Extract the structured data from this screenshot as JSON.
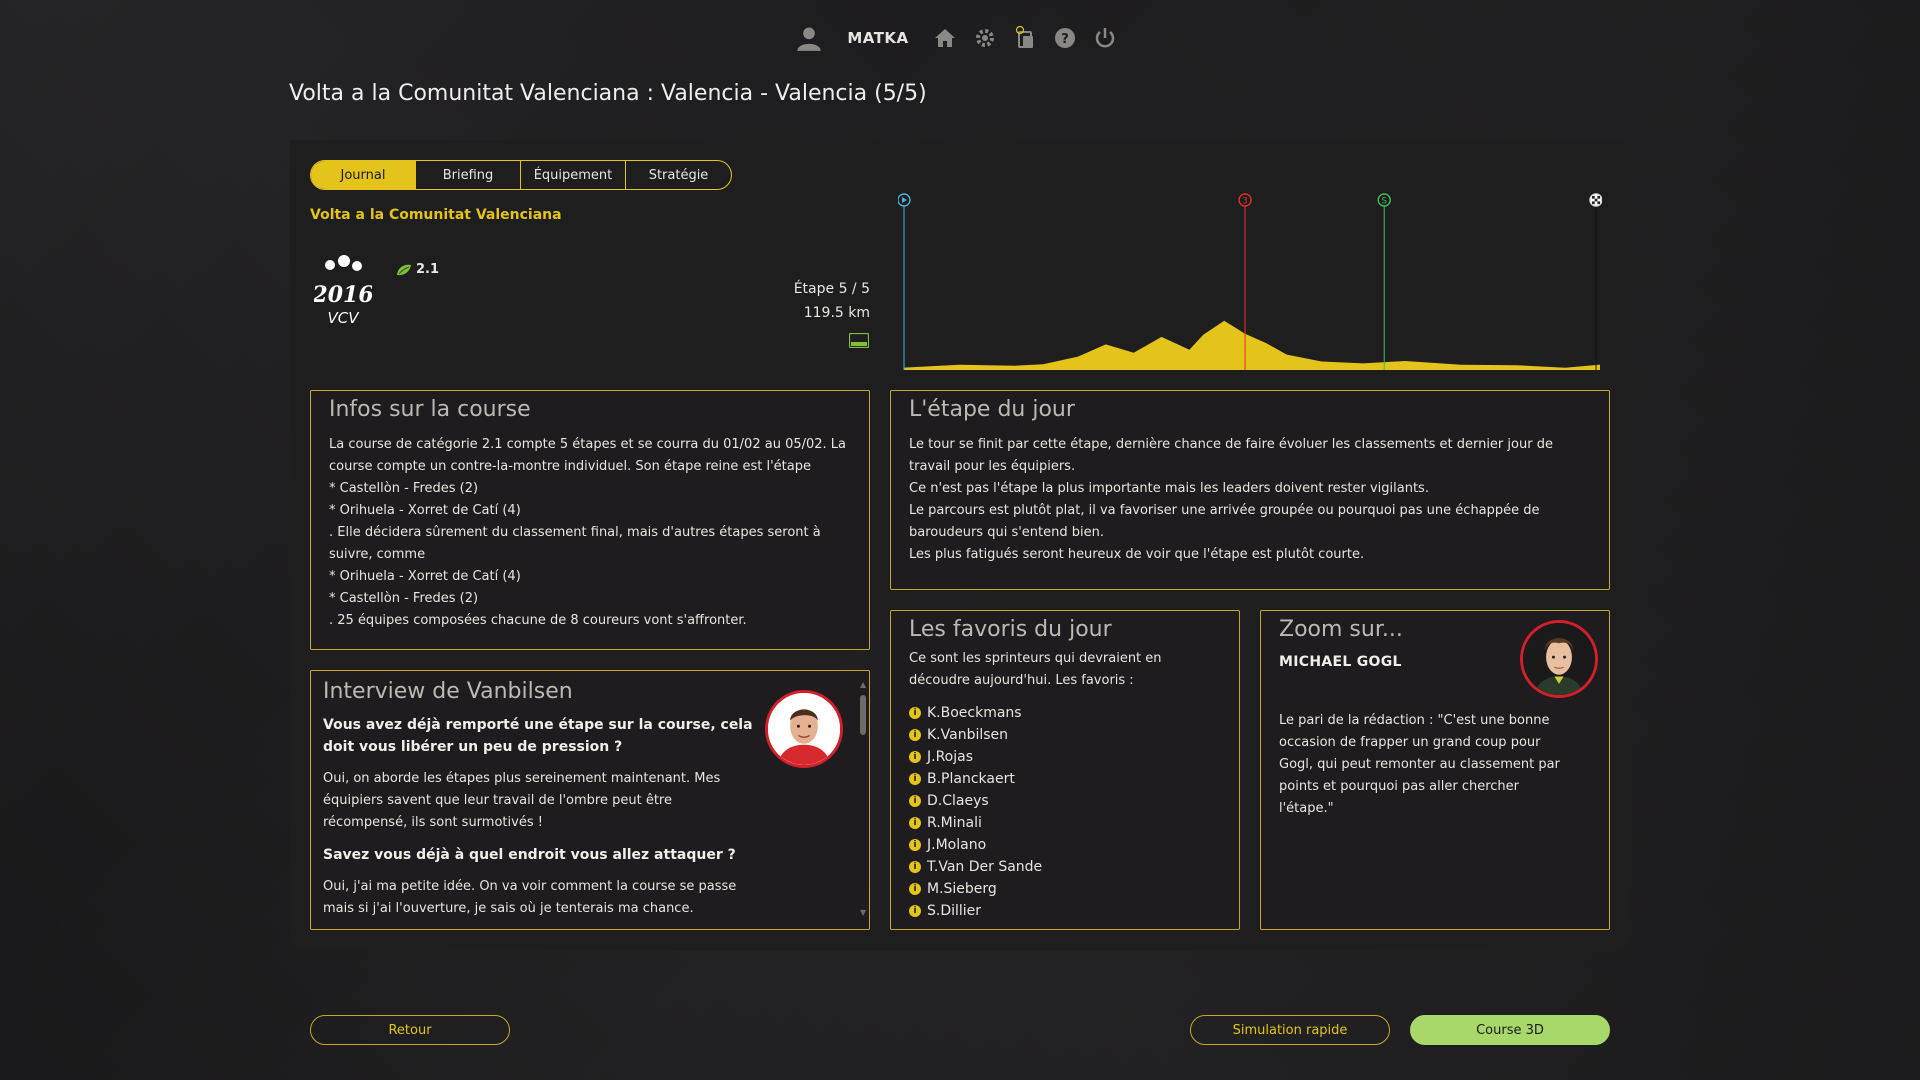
{
  "topbar": {
    "username": "MATKA",
    "icons": [
      "user-icon",
      "home-icon",
      "gear-icon",
      "cards-icon",
      "help-icon",
      "power-icon"
    ]
  },
  "page_title": "Volta a la Comunitat Valenciana : Valencia - Valencia (5/5)",
  "tabs": [
    {
      "label": "Journal",
      "active": true
    },
    {
      "label": "Briefing",
      "active": false
    },
    {
      "label": "Équipement",
      "active": false
    },
    {
      "label": "Stratégie",
      "active": false
    }
  ],
  "race": {
    "name": "Volta a la Comunitat Valenciana",
    "logo_year": "2016",
    "logo_abbr": "VCV",
    "category": "2.1",
    "stage": "Étape 5 / 5",
    "distance": "119.5 km"
  },
  "profile": {
    "markers": [
      {
        "type": "start",
        "label": "",
        "color": "#4fb0d8"
      },
      {
        "type": "climb",
        "label": "3",
        "color": "#e03030"
      },
      {
        "type": "sprint",
        "label": "S",
        "color": "#3fbf5a"
      },
      {
        "type": "finish",
        "label": "",
        "color": "#dddddd"
      }
    ],
    "fill_color": "#e4c41a"
  },
  "infos": {
    "title": "Infos sur la course",
    "lines": [
      "La course de catégorie 2.1 compte 5 étapes et se courra du 01/02 au 05/02. La course compte un contre-la-montre individuel. Son étape reine est l'étape",
      " * Castellòn - Fredes (2)",
      " * Orihuela - Xorret de Catí (4)",
      ". Elle décidera sûrement du classement final, mais d'autres étapes seront à suivre, comme",
      " * Orihuela - Xorret de Catí (4)",
      " * Castellòn - Fredes (2)",
      ". 25 équipes composées chacune de 8 coureurs vont s'affronter."
    ]
  },
  "etape": {
    "title": "L'étape du jour",
    "lines": [
      "Le tour se finit par cette étape, dernière chance de faire évoluer les classements et dernier jour de travail pour les équipiers.",
      "Ce n'est pas l'étape la plus importante mais les leaders doivent rester vigilants.",
      "Le parcours est plutôt plat, il va favoriser une arrivée groupée ou pourquoi pas une échappée de baroudeurs qui s'entend bien.",
      "Les plus fatigués seront heureux de voir que l'étape est plutôt courte."
    ]
  },
  "interview": {
    "title": "Interview de Vanbilsen",
    "q1": "Vous avez déjà remporté une étape sur la course, cela doit vous libérer un peu de pression ?",
    "a1": "Oui, on aborde les étapes plus sereinement maintenant. Mes équipiers savent que leur travail de l'ombre peut être récompensé, ils sont surmotivés !",
    "q2": "Savez vous déjà à quel endroit vous allez attaquer ?",
    "a2": "Oui, j'ai ma petite idée. On va voir comment la course se passe mais si j'ai l'ouverture, je sais où je tenterais ma chance."
  },
  "favoris": {
    "title": "Les favoris du jour",
    "intro": "Ce sont les sprinteurs qui devraient en découdre aujourd'hui. Les favoris :",
    "riders": [
      "K.Boeckmans",
      "K.Vanbilsen",
      "J.Rojas",
      "B.Planckaert",
      "D.Claeys",
      "R.Minali",
      "J.Molano",
      "T.Van Der Sande",
      "M.Sieberg",
      "S.Dillier"
    ]
  },
  "zoom": {
    "title": "Zoom sur...",
    "rider": "MICHAEL GOGL",
    "text": "Le pari de la rédaction : \"C'est une bonne occasion de frapper un grand coup pour Gogl, qui peut remonter au classement par points et pourquoi pas aller chercher l'étape.\""
  },
  "buttons": {
    "retour": "Retour",
    "simulation": "Simulation rapide",
    "course3d": "Course 3D"
  },
  "colors": {
    "accent": "#e4c41a",
    "green_button": "#a8d86a",
    "avatar_ring": "#d21f2a"
  }
}
